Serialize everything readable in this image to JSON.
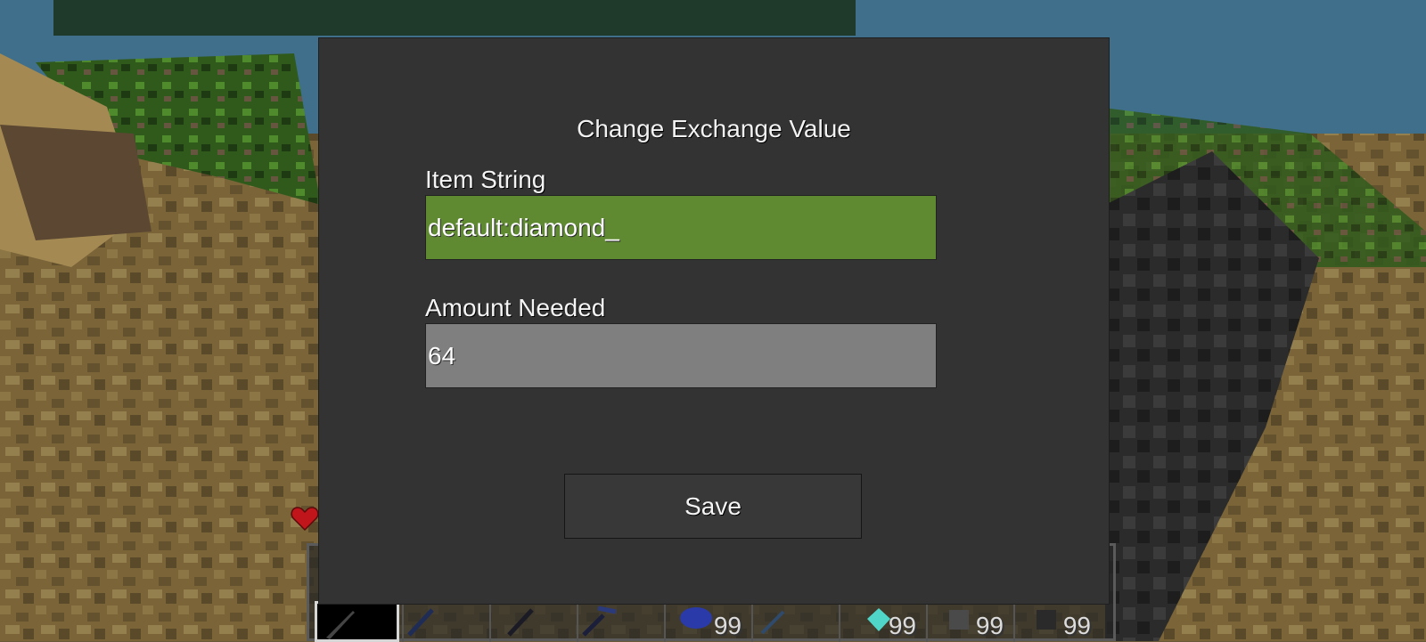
{
  "dialog": {
    "title": "Change Exchange Value",
    "item_string": {
      "label": "Item String",
      "value": "default:diamond_"
    },
    "amount_needed": {
      "label": "Amount Needed",
      "value": "64"
    },
    "save_label": "Save"
  },
  "hud": {
    "hotbar": {
      "selected_slot": 1,
      "slots": [
        {
          "icon": "sword-icon",
          "count": ""
        },
        {
          "icon": "stick-icon",
          "count": ""
        },
        {
          "icon": "stick-icon",
          "count": ""
        },
        {
          "icon": "pickaxe-icon",
          "count": ""
        },
        {
          "icon": "blue-block-icon",
          "count": "99"
        },
        {
          "icon": "tool-icon",
          "count": ""
        },
        {
          "icon": "diamond-icon",
          "count": "99"
        },
        {
          "icon": "block-icon",
          "count": "99"
        },
        {
          "icon": "block-icon",
          "count": "99"
        }
      ]
    },
    "health_icon": "heart-icon"
  },
  "colors": {
    "dialog_bg": "#333333",
    "active_field": "#5f8a32",
    "inactive_field": "#7f7f7f",
    "button_bg": "#383838"
  }
}
